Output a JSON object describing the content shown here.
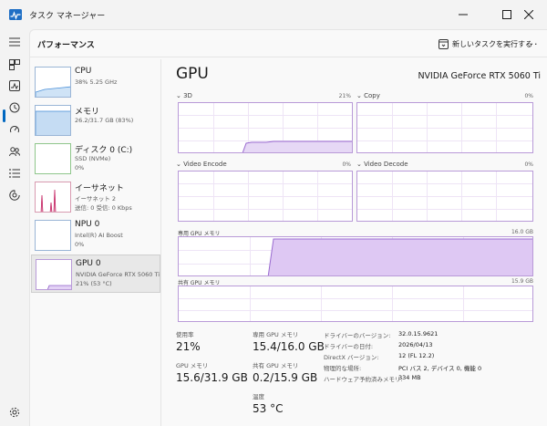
{
  "window": {
    "title": "タスク マネージャー",
    "accent_color": "#0067c0",
    "gpu_color": "#b99ad8"
  },
  "header": {
    "title": "パフォーマンス",
    "run_task_label": "新しいタスクを実行する",
    "more_label": "..."
  },
  "nav_icons": [
    "menu-icon",
    "processes-icon",
    "performance-icon",
    "app-history-icon",
    "startup-icon",
    "users-icon",
    "details-icon",
    "services-icon",
    "settings-icon"
  ],
  "sidebar": {
    "items": [
      {
        "name": "CPU",
        "line1": "38%  5.25 GHz",
        "line2": ""
      },
      {
        "name": "メモリ",
        "line1": "26.2/31.7 GB (83%)",
        "line2": ""
      },
      {
        "name": "ディスク 0 (C:)",
        "line1": "SSD (NVMe)",
        "line2": "0%"
      },
      {
        "name": "イーサネット",
        "line1": "イーサネット 2",
        "line2": "送信: 0  受信: 0 Kbps"
      },
      {
        "name": "NPU 0",
        "line1": "Intel(R) AI Boost",
        "line2": "0%"
      },
      {
        "name": "GPU 0",
        "line1": "NVIDIA GeForce RTX 5060 Ti",
        "line2": "21%  (53 °C)"
      }
    ]
  },
  "detail": {
    "title": "GPU",
    "model": "NVIDIA GeForce RTX 5060 Ti",
    "graphs": {
      "g3d": {
        "label": "3D",
        "pct": "21%"
      },
      "copy": {
        "label": "Copy",
        "pct": "0%"
      },
      "encode": {
        "label": "Video Encode",
        "pct": "0%"
      },
      "decode": {
        "label": "Video Decode",
        "pct": "0%"
      },
      "dedicated": {
        "label": "専用 GPU メモリ",
        "max": "16.0 GB"
      },
      "shared": {
        "label": "共有 GPU メモリ",
        "max": "15.9 GB"
      }
    },
    "stats": {
      "utilization_label": "使用率",
      "utilization_value": "21%",
      "gpu_memory_label": "GPU メモリ",
      "gpu_memory_value": "15.6/31.9 GB",
      "dedicated_label": "専用 GPU メモリ",
      "dedicated_value": "15.4/16.0 GB",
      "shared_label": "共有 GPU メモリ",
      "shared_value": "0.2/15.9 GB",
      "temp_label": "温度",
      "temp_value": "53 °C"
    },
    "info": [
      {
        "key": "ドライバーのバージョン:",
        "value": "32.0.15.9621"
      },
      {
        "key": "ドライバーの日付:",
        "value": "2026/04/13"
      },
      {
        "key": "DirectX バージョン:",
        "value": "12 (FL 12.2)"
      },
      {
        "key": "物理的な場所:",
        "value": "PCI バス 2, デバイス 0, 機能 0"
      },
      {
        "key": "ハードウェア予約済みメモリ:",
        "value": "334 MB"
      }
    ]
  }
}
